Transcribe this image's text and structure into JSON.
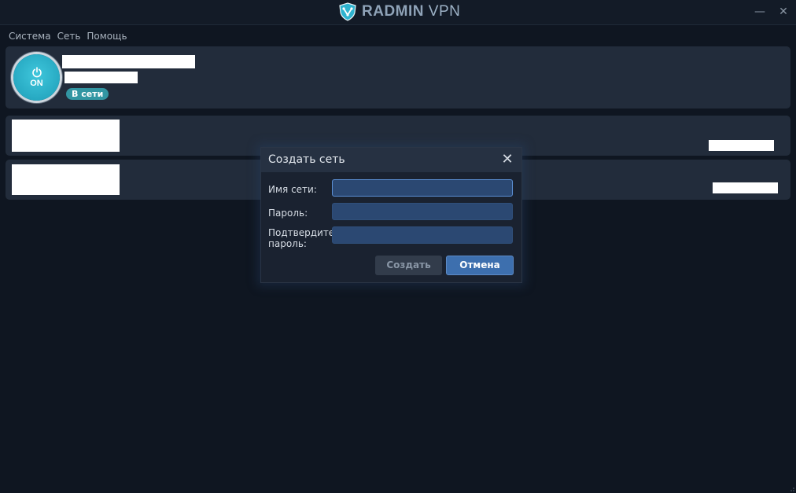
{
  "app": {
    "logo_brand": "RADMIN",
    "logo_product": "VPN"
  },
  "window_controls": {
    "minimize": "—",
    "close": "✕"
  },
  "menu": [
    {
      "label": "Система"
    },
    {
      "label": "Сеть"
    },
    {
      "label": "Помощь"
    }
  ],
  "status_panel": {
    "power_label": "ON",
    "status_badge": "В сети"
  },
  "dialog": {
    "title": "Создать сеть",
    "close_glyph": "✕",
    "fields": [
      {
        "label": "Имя сети:",
        "value": ""
      },
      {
        "label": "Пароль:",
        "value": ""
      },
      {
        "label": "Подтвердите пароль:",
        "value": ""
      }
    ],
    "create_button": "Создать",
    "cancel_button": "Отмена"
  },
  "colors": {
    "accent": "#3d6fae",
    "power_button": "#27a9c2",
    "badge": "#3296a3",
    "background": "#0f1621"
  }
}
